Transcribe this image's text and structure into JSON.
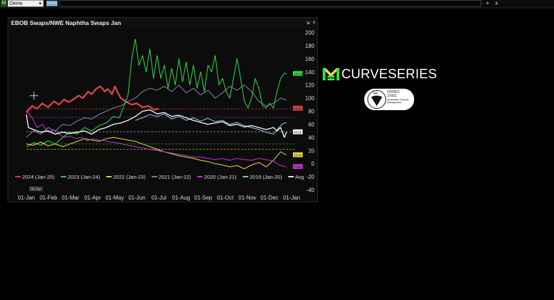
{
  "toolbar": {
    "app_icon": "bar-chart-icon",
    "workspace_value": "Demo",
    "tab_label": "Demo",
    "add_label": "+",
    "close_label": "x"
  },
  "panel": {
    "title": "EBOB Swaps/NWE Naphtha Swaps Jan",
    "pin_label": "⇲",
    "close_label": "x"
  },
  "logo": {
    "brand": "CURVESERIES",
    "iso_bsi": "bsi.",
    "iso_standard": "ISO/IEC",
    "iso_number": "27001",
    "iso_caption_1": "Information Security",
    "iso_caption_2": "Management"
  },
  "chart_data": {
    "type": "line",
    "x_ticks": [
      "01-Jan",
      "01-Feb",
      "01-Mar",
      "01-Apr",
      "01-May",
      "01-Jun",
      "01-Jul",
      "01-Aug",
      "01-Sep",
      "01-Oct",
      "01-Nov",
      "01-Dec",
      "01-Jan"
    ],
    "crosshair_label": "09-Jan",
    "ylim": [
      -40,
      200
    ],
    "y_ticks": [
      200,
      180,
      160,
      140,
      120,
      100,
      80,
      60,
      40,
      20,
      0,
      -20,
      -40
    ],
    "grid": false,
    "legend_position": "bottom-left",
    "x_domain": [
      0,
      365
    ],
    "series": [
      {
        "name": "2024 (Jan-25)",
        "color": "#e84545",
        "width": 2.2,
        "points": [
          [
            0,
            78
          ],
          [
            8,
            88
          ],
          [
            15,
            84
          ],
          [
            22,
            92
          ],
          [
            30,
            86
          ],
          [
            38,
            95
          ],
          [
            45,
            90
          ],
          [
            52,
            98
          ],
          [
            58,
            94
          ],
          [
            65,
            98
          ],
          [
            72,
            104
          ],
          [
            78,
            100
          ],
          [
            85,
            110
          ],
          [
            90,
            106
          ],
          [
            96,
            114
          ],
          [
            102,
            118
          ],
          [
            108,
            110
          ],
          [
            112,
            114
          ],
          [
            118,
            106
          ],
          [
            122,
            118
          ],
          [
            126,
            108
          ],
          [
            130,
            100
          ],
          [
            138,
            94
          ],
          [
            145,
            90
          ],
          [
            152,
            92
          ],
          [
            160,
            86
          ],
          [
            168,
            88
          ],
          [
            176,
            82
          ],
          [
            182,
            84
          ]
        ],
        "last_label": "83.59",
        "label_bg": "#e84545"
      },
      {
        "name": "2023 (Jan-24)",
        "color": "#2ee04a",
        "width": 1,
        "points": [
          [
            0,
            25
          ],
          [
            10,
            32
          ],
          [
            20,
            28
          ],
          [
            30,
            35
          ],
          [
            40,
            30
          ],
          [
            50,
            40
          ],
          [
            60,
            48
          ],
          [
            70,
            45
          ],
          [
            80,
            55
          ],
          [
            90,
            50
          ],
          [
            100,
            58
          ],
          [
            110,
            62
          ],
          [
            120,
            72
          ],
          [
            128,
            70
          ],
          [
            135,
            90
          ],
          [
            140,
            105
          ],
          [
            145,
            160
          ],
          [
            150,
            190
          ],
          [
            155,
            150
          ],
          [
            160,
            165
          ],
          [
            165,
            140
          ],
          [
            170,
            175
          ],
          [
            175,
            130
          ],
          [
            180,
            165
          ],
          [
            185,
            130
          ],
          [
            190,
            150
          ],
          [
            195,
            115
          ],
          [
            200,
            145
          ],
          [
            205,
            120
          ],
          [
            210,
            160
          ],
          [
            215,
            125
          ],
          [
            220,
            155
          ],
          [
            225,
            120
          ],
          [
            230,
            150
          ],
          [
            235,
            115
          ],
          [
            240,
            140
          ],
          [
            245,
            110
          ],
          [
            250,
            150
          ],
          [
            255,
            140
          ],
          [
            260,
            165
          ],
          [
            265,
            120
          ],
          [
            270,
            130
          ],
          [
            275,
            110
          ],
          [
            280,
            100
          ],
          [
            285,
            130
          ],
          [
            290,
            160
          ],
          [
            295,
            130
          ],
          [
            300,
            95
          ],
          [
            305,
            85
          ],
          [
            310,
            100
          ],
          [
            315,
            130
          ],
          [
            320,
            115
          ],
          [
            325,
            88
          ],
          [
            330,
            85
          ],
          [
            335,
            92
          ],
          [
            340,
            85
          ],
          [
            345,
            110
          ],
          [
            350,
            130
          ],
          [
            355,
            138
          ],
          [
            358,
            137
          ]
        ],
        "last_label": "137.25",
        "label_bg": "#2ee04a"
      },
      {
        "name": "2022 (Jan-23)",
        "color": "#f0e040",
        "width": 1,
        "points": [
          [
            0,
            30
          ],
          [
            10,
            28
          ],
          [
            20,
            33
          ],
          [
            30,
            27
          ],
          [
            40,
            30
          ],
          [
            50,
            26
          ],
          [
            60,
            30
          ],
          [
            70,
            34
          ],
          [
            80,
            38
          ],
          [
            90,
            36
          ],
          [
            100,
            34
          ],
          [
            110,
            38
          ],
          [
            120,
            40
          ],
          [
            130,
            38
          ],
          [
            140,
            36
          ],
          [
            150,
            34
          ],
          [
            160,
            30
          ],
          [
            170,
            26
          ],
          [
            180,
            22
          ],
          [
            190,
            18
          ],
          [
            200,
            15
          ],
          [
            210,
            12
          ],
          [
            220,
            10
          ],
          [
            230,
            8
          ],
          [
            240,
            5
          ],
          [
            250,
            3
          ],
          [
            260,
            0
          ],
          [
            270,
            -2
          ],
          [
            280,
            -5
          ],
          [
            290,
            -3
          ],
          [
            300,
            -8
          ],
          [
            310,
            -2
          ],
          [
            320,
            2
          ],
          [
            330,
            -5
          ],
          [
            340,
            5
          ],
          [
            350,
            18
          ],
          [
            355,
            15
          ],
          [
            358,
            13
          ]
        ],
        "last_label": "13.54",
        "label_bg": "#f0e040"
      },
      {
        "name": "2021 (Jan-22)",
        "color": "#7a8fb0",
        "width": 1,
        "points": [
          [
            0,
            40
          ],
          [
            10,
            50
          ],
          [
            20,
            45
          ],
          [
            30,
            55
          ],
          [
            40,
            50
          ],
          [
            50,
            60
          ],
          [
            60,
            58
          ],
          [
            70,
            65
          ],
          [
            80,
            70
          ],
          [
            90,
            68
          ],
          [
            100,
            75
          ],
          [
            110,
            80
          ],
          [
            120,
            85
          ],
          [
            130,
            88
          ],
          [
            140,
            95
          ],
          [
            150,
            100
          ],
          [
            160,
            110
          ],
          [
            170,
            115
          ],
          [
            180,
            112
          ],
          [
            190,
            118
          ],
          [
            200,
            110
          ],
          [
            210,
            120
          ],
          [
            220,
            108
          ],
          [
            230,
            115
          ],
          [
            240,
            105
          ],
          [
            250,
            112
          ],
          [
            260,
            100
          ],
          [
            270,
            108
          ],
          [
            280,
            118
          ],
          [
            290,
            112
          ],
          [
            300,
            120
          ],
          [
            310,
            110
          ],
          [
            320,
            95
          ],
          [
            330,
            88
          ],
          [
            340,
            92
          ],
          [
            350,
            100
          ],
          [
            358,
            97
          ]
        ],
        "last_label": "",
        "label_bg": ""
      },
      {
        "name": "2020 (Jan-21)",
        "color": "#cc33dd",
        "width": 1,
        "points": [
          [
            0,
            80
          ],
          [
            8,
            70
          ],
          [
            15,
            55
          ],
          [
            22,
            60
          ],
          [
            30,
            48
          ],
          [
            38,
            52
          ],
          [
            45,
            45
          ],
          [
            52,
            40
          ],
          [
            60,
            42
          ],
          [
            68,
            38
          ],
          [
            76,
            40
          ],
          [
            84,
            35
          ],
          [
            92,
            38
          ],
          [
            100,
            36
          ],
          [
            108,
            35
          ],
          [
            116,
            33
          ],
          [
            124,
            32
          ],
          [
            132,
            30
          ],
          [
            140,
            28
          ],
          [
            150,
            26
          ],
          [
            160,
            24
          ],
          [
            170,
            22
          ],
          [
            180,
            20
          ],
          [
            190,
            18
          ],
          [
            200,
            16
          ],
          [
            210,
            14
          ],
          [
            220,
            12
          ],
          [
            230,
            10
          ],
          [
            240,
            10
          ],
          [
            250,
            8
          ],
          [
            260,
            6
          ],
          [
            270,
            8
          ],
          [
            280,
            5
          ],
          [
            290,
            8
          ],
          [
            300,
            6
          ],
          [
            310,
            5
          ],
          [
            320,
            8
          ],
          [
            330,
            6
          ],
          [
            340,
            4
          ],
          [
            348,
            -2
          ],
          [
            354,
            -4
          ],
          [
            358,
            -5
          ]
        ],
        "last_label": "70.82",
        "label_bg": "#cc33dd"
      },
      {
        "name": "2019 (Jan-20)",
        "color": "#88ddee",
        "width": 1,
        "points": [
          [
            150,
            66
          ],
          [
            160,
            70
          ],
          [
            170,
            75
          ],
          [
            180,
            72
          ],
          [
            190,
            76
          ],
          [
            200,
            68
          ],
          [
            210,
            72
          ],
          [
            220,
            66
          ],
          [
            230,
            70
          ],
          [
            240,
            65
          ],
          [
            250,
            69
          ],
          [
            260,
            64
          ],
          [
            270,
            66
          ],
          [
            280,
            60
          ],
          [
            290,
            63
          ],
          [
            300,
            58
          ],
          [
            310,
            55
          ],
          [
            320,
            52
          ],
          [
            330,
            48
          ],
          [
            340,
            45
          ],
          [
            350,
            58
          ],
          [
            355,
            62
          ],
          [
            358,
            62
          ]
        ],
        "last_label": "",
        "label_bg": ""
      },
      {
        "name": "Avg",
        "color": "#ffffff",
        "width": 1.3,
        "points": [
          [
            0,
            75
          ],
          [
            3,
            55
          ],
          [
            10,
            52
          ],
          [
            20,
            48
          ],
          [
            30,
            50
          ],
          [
            40,
            45
          ],
          [
            50,
            48
          ],
          [
            60,
            46
          ],
          [
            70,
            48
          ],
          [
            80,
            50
          ],
          [
            90,
            45
          ],
          [
            100,
            52
          ],
          [
            110,
            55
          ],
          [
            120,
            60
          ],
          [
            130,
            62
          ],
          [
            140,
            66
          ],
          [
            150,
            72
          ],
          [
            160,
            80
          ],
          [
            170,
            82
          ],
          [
            180,
            76
          ],
          [
            190,
            78
          ],
          [
            200,
            72
          ],
          [
            210,
            74
          ],
          [
            220,
            70
          ],
          [
            230,
            66
          ],
          [
            240,
            63
          ],
          [
            250,
            60
          ],
          [
            260,
            62
          ],
          [
            270,
            64
          ],
          [
            280,
            58
          ],
          [
            290,
            60
          ],
          [
            300,
            56
          ],
          [
            310,
            58
          ],
          [
            320,
            55
          ],
          [
            330,
            52
          ],
          [
            340,
            55
          ],
          [
            345,
            50
          ],
          [
            350,
            55
          ],
          [
            355,
            40
          ],
          [
            358,
            48
          ]
        ],
        "last_label": "48.68",
        "label_bg": "#ffffff"
      }
    ],
    "reference_lines": [
      {
        "value": 83.59,
        "color": "#e84545"
      },
      {
        "value": 70.82,
        "color": "#cc33dd"
      },
      {
        "value": 48.68,
        "color": "#cccccc"
      },
      {
        "value": 30,
        "color": "#2ee04a"
      },
      {
        "value": 22,
        "color": "#f0e040"
      }
    ]
  }
}
